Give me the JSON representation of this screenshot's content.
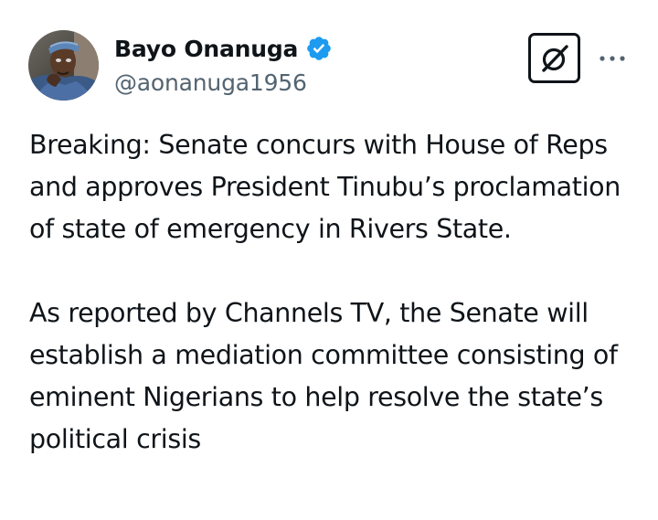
{
  "author": {
    "name": "Bayo Onanuga",
    "handle": "@aonanuga1956",
    "verified": true,
    "verified_color": "#1d9bf0"
  },
  "actions": {
    "grok_icon": "grok-icon",
    "more_icon": "more-horizontal-icon"
  },
  "tweet": {
    "paragraphs": [
      "Breaking: Senate concurs with House of Reps and approves President Tinubu’s proclamation of state of emergency in Rivers State.",
      "As reported by Channels TV, the Senate will establish a mediation committee consisting of eminent Nigerians to help resolve the state’s political crisis"
    ]
  },
  "colors": {
    "text": "#0f1419",
    "secondary": "#536471"
  }
}
